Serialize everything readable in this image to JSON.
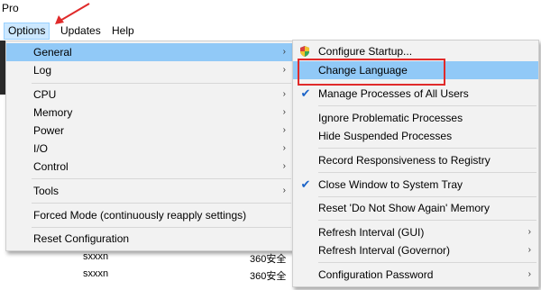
{
  "window": {
    "title": "Pro"
  },
  "menubar": {
    "items": [
      "Options",
      "Updates",
      "Help"
    ]
  },
  "background_rows": [
    {
      "user": "sxxxn",
      "desc": "360安全"
    },
    {
      "user": "sxxxn",
      "desc": "360安全"
    }
  ],
  "options_menu": {
    "items": [
      {
        "label": "General",
        "submenu": true,
        "highlighted": true
      },
      {
        "label": "Log",
        "submenu": true
      },
      {
        "label": "CPU",
        "submenu": true
      },
      {
        "label": "Memory",
        "submenu": true
      },
      {
        "label": "Power",
        "submenu": true
      },
      {
        "label": "I/O",
        "submenu": true
      },
      {
        "label": "Control",
        "submenu": true
      },
      {
        "label": "Tools",
        "submenu": true
      },
      {
        "label": "Forced Mode (continuously reapply settings)",
        "submenu": false
      },
      {
        "label": "Reset Configuration",
        "submenu": false
      }
    ]
  },
  "general_submenu": {
    "items": [
      {
        "label": "Configure Startup...",
        "icon": "shield-icon"
      },
      {
        "label": "Change Language",
        "highlighted": true
      },
      {
        "label": "Manage Processes of All Users",
        "checked": true
      },
      {
        "label": "Ignore Problematic Processes"
      },
      {
        "label": "Hide Suspended Processes"
      },
      {
        "label": "Record Responsiveness to Registry"
      },
      {
        "label": "Close Window to System Tray",
        "checked": true
      },
      {
        "label": "Reset 'Do Not Show Again' Memory"
      },
      {
        "label": "Refresh Interval (GUI)",
        "submenu": true
      },
      {
        "label": "Refresh Interval (Governor)",
        "submenu": true
      },
      {
        "label": "Configuration Password",
        "submenu": true
      }
    ]
  },
  "colors": {
    "highlight": "#91c9f7",
    "annotation": "#e02a2a",
    "check": "#1a63c8"
  }
}
